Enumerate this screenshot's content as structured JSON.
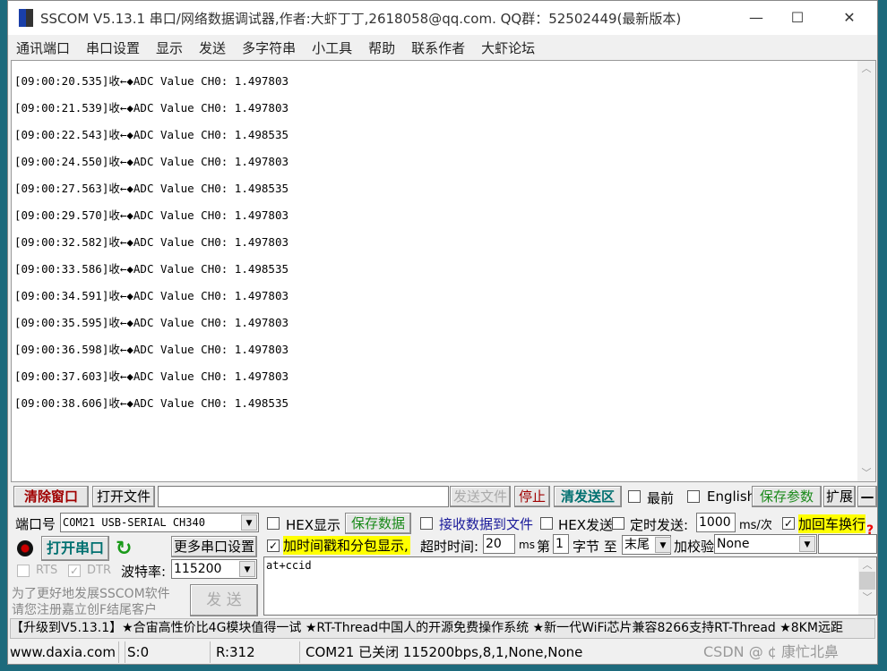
{
  "window": {
    "title": "SSCOM V5.13.1 串口/网络数据调试器,作者:大虾丁丁,2618058@qq.com. QQ群：52502449(最新版本)",
    "minimize": "—",
    "maximize": "☐",
    "close": "✕"
  },
  "menu": [
    "通讯端口",
    "串口设置",
    "显示",
    "发送",
    "多字符串",
    "小工具",
    "帮助",
    "联系作者",
    "大虾论坛"
  ],
  "receive_lines": [
    "[09:00:20.535]收←◆ADC Value CH0: 1.497803",
    "[09:00:21.539]收←◆ADC Value CH0: 1.497803",
    "[09:00:22.543]收←◆ADC Value CH0: 1.498535",
    "[09:00:24.550]收←◆ADC Value CH0: 1.497803",
    "[09:00:27.563]收←◆ADC Value CH0: 1.498535",
    "[09:00:29.570]收←◆ADC Value CH0: 1.497803",
    "[09:00:32.582]收←◆ADC Value CH0: 1.497803",
    "[09:00:33.586]收←◆ADC Value CH0: 1.498535",
    "[09:00:34.591]收←◆ADC Value CH0: 1.497803",
    "[09:00:35.595]收←◆ADC Value CH0: 1.497803",
    "[09:00:36.598]收←◆ADC Value CH0: 1.497803",
    "[09:00:37.603]收←◆ADC Value CH0: 1.497803",
    "[09:00:38.606]收←◆ADC Value CH0: 1.498535"
  ],
  "toolbar": {
    "clear": "清除窗口",
    "open_file": "打开文件",
    "file_path": "",
    "send_file": "发送文件",
    "stop": "停止",
    "clear_send": "清发送区",
    "topmost": "最前",
    "english": "English",
    "save_params": "保存参数",
    "expand": "扩展",
    "collapse": "—"
  },
  "port": {
    "label": "端口号",
    "value": "COM21 USB-SERIAL CH340",
    "open": "打开串口",
    "more": "更多串口设置",
    "rts": "RTS",
    "dtr": "DTR",
    "baud_label": "波特率:",
    "baud": "115200",
    "promo1": "为了更好地发展SSCOM软件",
    "promo2": "请您注册嘉立创F结尾客户",
    "send": "发  送"
  },
  "options": {
    "hex_display": "HEX显示",
    "save_data": "保存数据",
    "recv_to_file": "接收数据到文件",
    "hex_send": "HEX发送",
    "timed_send": "定时发送:",
    "interval": "1000",
    "interval_unit": "ms/次",
    "add_crlf": "加回车换行",
    "timestamp": "加时间戳和分包显示,",
    "timeout_label": "超时时间:",
    "timeout": "20",
    "timeout_unit": "ms",
    "byte_prefix": "第",
    "byte_from": "1",
    "byte_suffix": "字节 至",
    "byte_to": "末尾",
    "checksum_label": "加校验",
    "checksum": "None",
    "help": "?"
  },
  "send_text": "at+ccid",
  "ticker": "【升级到V5.13.1】★合宙高性价比4G模块值得一试 ★RT-Thread中国人的开源免费操作系统 ★新一代WiFi芯片兼容8266支持RT-Thread ★8KM远距",
  "status": {
    "site": "www.daxia.com",
    "sent": "S:0",
    "recv": "R:312",
    "port_state": "COM21 已关闭  115200bps,8,1,None,None"
  },
  "watermark": "CSDN @ ¢ 康忙北鼻"
}
